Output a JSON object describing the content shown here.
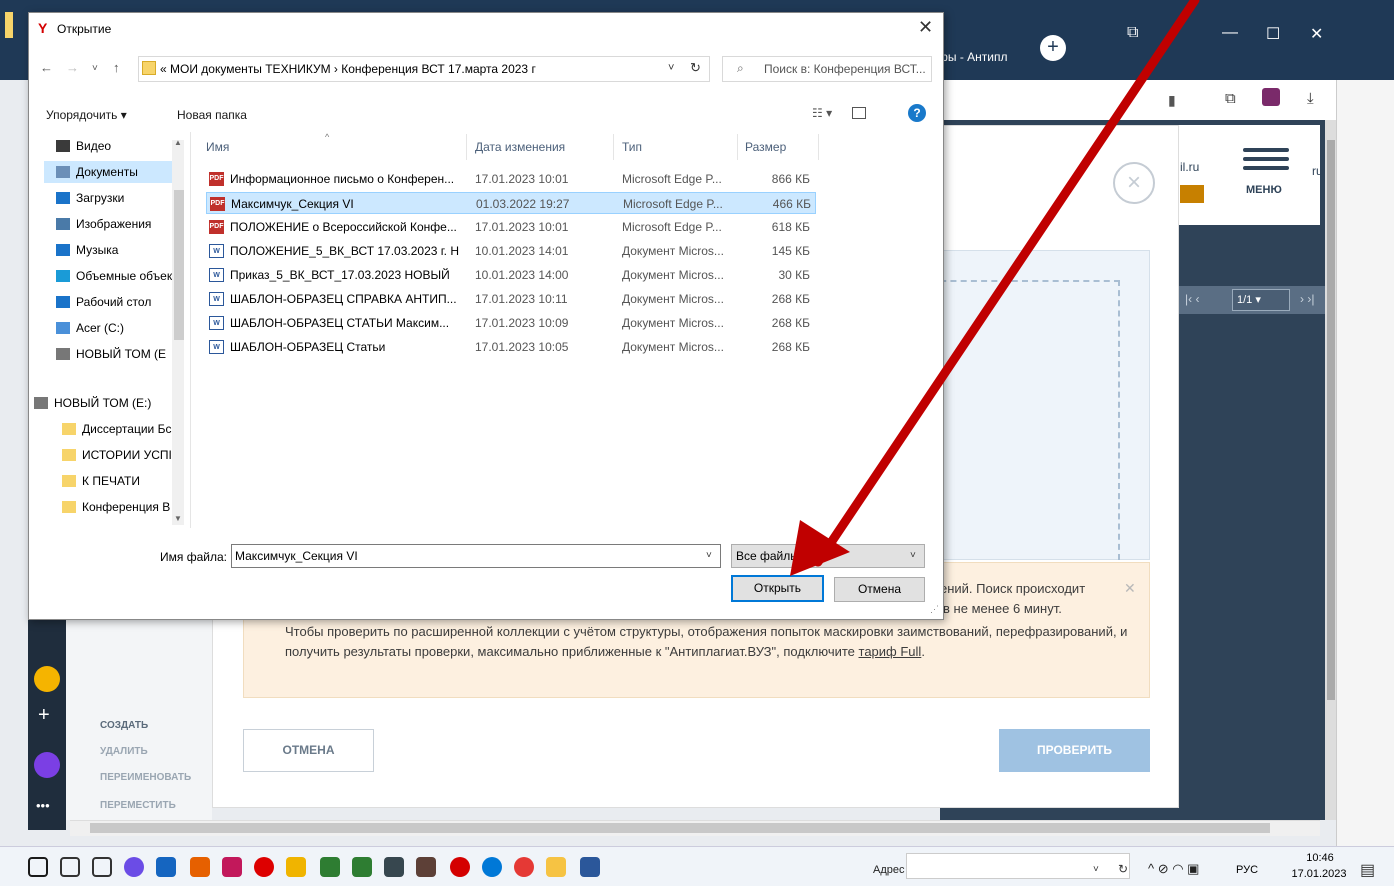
{
  "browser": {
    "tab_title": "фы - Антипл",
    "site_domain_frag": "il.ru",
    "site_frag2": "ru",
    "menu_label": "МЕНЮ",
    "pager_value": "1/1"
  },
  "app_sidebar": {
    "items": [
      "СОЗДАТЬ",
      "УДАЛИТЬ",
      "ПЕРЕИМЕНОВАТЬ",
      "ПЕРЕМЕСТИТЬ"
    ]
  },
  "modal": {
    "warning_tail1": "ений. Поиск происходит",
    "warning_tail2": "тов не менее 6 минут.",
    "warning_body": "Чтобы проверить по расширенной коллекции с учётом структуры, отображения попыток маскировки заимствований, перефразирований, и получить результаты проверки, максимально приближенные к \"Антиплагиат.ВУЗ\", подключите ",
    "warning_link": "тариф Full",
    "warning_end": ".",
    "cancel_label": "ОТМЕНА",
    "check_label": "ПРОВЕРИТЬ"
  },
  "dialog": {
    "title": "Открытие",
    "address": "« МОИ документы ТЕХНИКУМ  ›  Конференция ВСТ 17.марта 2023 г",
    "search_placeholder": "Поиск в: Конференция ВСТ...",
    "organize_label": "Упорядочить ▾",
    "new_folder_label": "Новая папка",
    "nav_items": [
      {
        "label": "Видео",
        "color": "#3a3a3a"
      },
      {
        "label": "Документы",
        "color": "#6b8fb8"
      },
      {
        "label": "Загрузки",
        "color": "#1a73c9"
      },
      {
        "label": "Изображения",
        "color": "#4a7aa8"
      },
      {
        "label": "Музыка",
        "color": "#1a73c9"
      },
      {
        "label": "Объемные объекты",
        "color": "#1a9bd7"
      },
      {
        "label": "Рабочий стол",
        "color": "#1a73c9"
      },
      {
        "label": "Acer (C:)",
        "color": "#4a90d9"
      },
      {
        "label": "НОВЫЙ ТОМ (E",
        "color": "#777"
      },
      {
        "label": "НОВЫЙ ТОМ (E:)",
        "color": "#777"
      },
      {
        "label": "Диссертации Бс",
        "color": "#f7d46a"
      },
      {
        "label": "ИСТОРИИ УСПІ",
        "color": "#f7d46a"
      },
      {
        "label": "К ПЕЧАТИ",
        "color": "#f7d46a"
      },
      {
        "label": "Конференция В",
        "color": "#f7d46a"
      }
    ],
    "columns": {
      "name": "Имя",
      "date": "Дата изменения",
      "type": "Тип",
      "size": "Размер"
    },
    "files": [
      {
        "icon": "pdf",
        "name": "Информационное письмо о Конферен...",
        "date": "17.01.2023 10:01",
        "type": "Microsoft Edge P...",
        "size": "866 КБ"
      },
      {
        "icon": "pdf",
        "name": "Максимчук_Секция VI",
        "date": "01.03.2022 19:27",
        "type": "Microsoft Edge P...",
        "size": "466 КБ",
        "selected": true
      },
      {
        "icon": "pdf",
        "name": "ПОЛОЖЕНИЕ о Всероссийской Конфе...",
        "date": "17.01.2023 10:01",
        "type": "Microsoft Edge P...",
        "size": "618 КБ"
      },
      {
        "icon": "doc",
        "name": "ПОЛОЖЕНИЕ_5_ВК_ВСТ 17.03.2023 г. Н...",
        "date": "10.01.2023 14:01",
        "type": "Документ Micros...",
        "size": "145 КБ"
      },
      {
        "icon": "doc",
        "name": "Приказ_5_ВК_ВСТ_17.03.2023 НОВЫЙ",
        "date": "10.01.2023 14:00",
        "type": "Документ Micros...",
        "size": "30 КБ"
      },
      {
        "icon": "doc",
        "name": "ШАБЛОН-ОБРАЗЕЦ СПРАВКА АНТИП...",
        "date": "17.01.2023 10:11",
        "type": "Документ Micros...",
        "size": "268 КБ"
      },
      {
        "icon": "doc",
        "name": "ШАБЛОН-ОБРАЗЕЦ СТАТЬИ  Максим...",
        "date": "17.01.2023 10:09",
        "type": "Документ Micros...",
        "size": "268 КБ"
      },
      {
        "icon": "doc",
        "name": "ШАБЛОН-ОБРАЗЕЦ Статьи",
        "date": "17.01.2023 10:05",
        "type": "Документ Micros...",
        "size": "268 КБ"
      }
    ],
    "filename_label": "Имя файла:",
    "filename_value": "Максимчук_Секция VI",
    "filter_value": "Все файлы",
    "open_label": "Открыть",
    "cancel_label": "Отмена"
  },
  "taskbar": {
    "address_label": "Адрес",
    "lang": "РУС",
    "time": "10:46",
    "date": "17.01.2023",
    "icons": [
      "start-icon",
      "search-icon",
      "taskview-icon",
      "browser-circle-icon",
      "mail-icon",
      "firefox-icon",
      "photoshop-icon",
      "opera-icon",
      "explorer-icon",
      "photos-icon",
      "notes-icon",
      "tank-game-icon",
      "shield-game-icon",
      "yandex-icon",
      "edge-icon",
      "yandex-browser-icon",
      "folder-icon",
      "word-icon"
    ]
  },
  "accent": {
    "arrow": "#c00000",
    "dialog_select": "#cce8ff",
    "check_button": "#9fc2e2"
  }
}
